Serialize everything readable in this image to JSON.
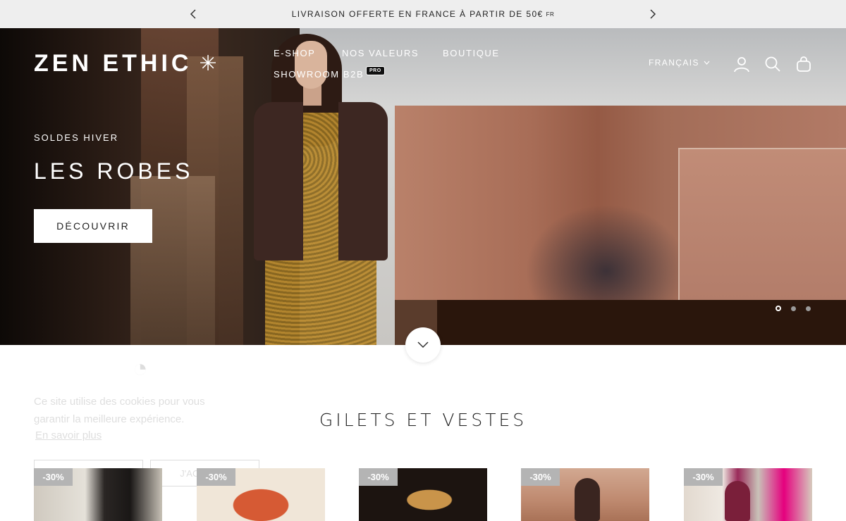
{
  "announcement": {
    "text": "LIVRAISON OFFERTE EN FRANCE À PARTIR DE 50€",
    "flag": "FR"
  },
  "header": {
    "logo": "ZEN ETHIC",
    "logo_mark": "✳",
    "nav": [
      {
        "label": "E-SHOP"
      },
      {
        "label": "NOS VALEURS"
      },
      {
        "label": "BOUTIQUE"
      },
      {
        "label": "SHOWROOM B2B",
        "badge": "PRO"
      }
    ],
    "language": "FRANÇAIS",
    "icons": [
      "account-icon",
      "search-icon",
      "cart-icon"
    ]
  },
  "hero": {
    "eyebrow": "SOLDES HIVER",
    "title": "LES ROBES",
    "cta": "DÉCOUVRIR",
    "slides_total": 3,
    "active_slide": 1
  },
  "cookie_banner": {
    "text": "Ce site utilise des cookies pour vous garantir la meilleure expérience.",
    "link": "En savoir plus",
    "accept_label": "J'ACCEPTE"
  },
  "section": {
    "title": "GILETS ET VESTES"
  },
  "products": [
    {
      "discount": "-30%"
    },
    {
      "discount": "-30%"
    },
    {
      "discount": "-30%"
    },
    {
      "discount": "-30%"
    },
    {
      "discount": "-30%"
    }
  ],
  "colors": {
    "announcement_bg": "#eeeeee",
    "discount_badge": "#b4b4b4",
    "text": "#1c1c1c"
  }
}
